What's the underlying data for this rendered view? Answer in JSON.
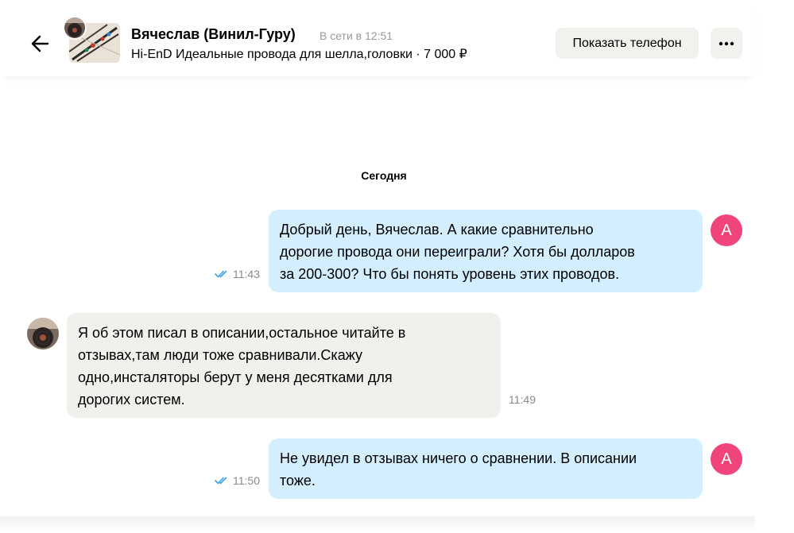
{
  "header": {
    "seller_name": "Вячеслав (Винил-Гуру)",
    "status": "В сети в 12:51",
    "ad_title": "Hi-EnD Идеальные провода для шелла,головки · 7 000 ₽",
    "show_phone_label": "Показать телефон",
    "icons": {
      "back": "arrow-left-icon",
      "more": "ellipsis-icon"
    }
  },
  "chat": {
    "date_separator": "Сегодня",
    "messages": [
      {
        "direction": "outgoing",
        "lines": [
          "Добрый день, Вячеслав. А какие сравнительно",
          "дорогие провода они переиграли? Хотя бы долларов",
          "за 200-300? Что бы понять уровень этих проводов."
        ],
        "time": "11:43",
        "read": true,
        "avatar_letter": "A"
      },
      {
        "direction": "incoming",
        "lines": [
          "Я об этом писал в описании,остальное читайте в",
          "отзывах,там люди тоже сравнивали.Скажу",
          "одно,инсталяторы берут у меня десятками для",
          "дорогих систем."
        ],
        "time": "11:49"
      },
      {
        "direction": "outgoing",
        "lines": [
          "Не увидел в отзывах ничего о сравнении. В описании",
          "тоже."
        ],
        "time": "11:50",
        "read": true,
        "avatar_letter": "A"
      }
    ]
  },
  "colors": {
    "outgoing_bubble": "#d3eefe",
    "incoming_bubble": "#f2f0ec",
    "avatar_pink": "#f0457a",
    "read_check": "#3aa0e6",
    "button_bg": "#f2f1ee"
  }
}
